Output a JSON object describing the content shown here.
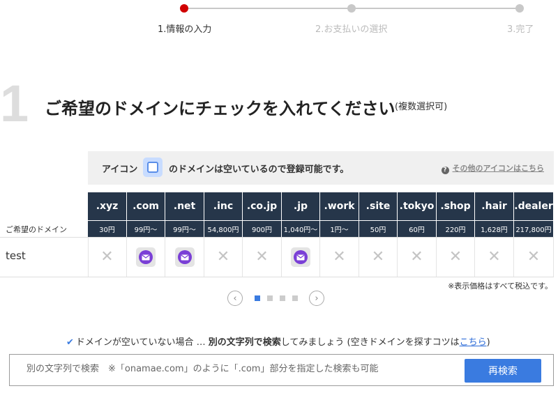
{
  "stepper": {
    "steps": [
      {
        "label": "1.情報の入力"
      },
      {
        "label": "2.お支払いの選択"
      },
      {
        "label": "3.完了"
      }
    ]
  },
  "section": {
    "number": "1",
    "title": "ご希望のドメインにチェックを入れてください",
    "subtitle": "(複数選択可)"
  },
  "legend": {
    "prefix": "アイコン",
    "suffix": "のドメインは空いているので登録可能です。",
    "help_link": "その他のアイコンはこちら"
  },
  "table": {
    "row_label": "ご希望のドメイン",
    "query": "test",
    "tlds": [
      {
        "name": ".xyz",
        "price": "30円",
        "status": "unavailable"
      },
      {
        "name": ".com",
        "price": "99円〜",
        "status": "available"
      },
      {
        "name": ".net",
        "price": "99円〜",
        "status": "available"
      },
      {
        "name": ".inc",
        "price": "54,800円",
        "status": "unavailable"
      },
      {
        "name": ".co.jp",
        "price": "900円",
        "status": "unavailable"
      },
      {
        "name": ".jp",
        "price": "1,040円〜",
        "status": "available"
      },
      {
        "name": ".work",
        "price": "1円〜",
        "status": "unavailable"
      },
      {
        "name": ".site",
        "price": "50円",
        "status": "unavailable"
      },
      {
        "name": ".tokyo",
        "price": "60円",
        "status": "unavailable"
      },
      {
        "name": ".shop",
        "price": "220円",
        "status": "unavailable"
      },
      {
        "name": ".hair",
        "price": "1,628円",
        "status": "unavailable"
      },
      {
        "name": ".dealer",
        "price": "217,800円",
        "status": "unavailable"
      }
    ],
    "tax_note": "※表示価格はすべて税込です。"
  },
  "pagination": {
    "pages": 4,
    "current": 1
  },
  "tip": {
    "pre": "ドメインが空いていない場合 … ",
    "bold": "別の文字列で検索",
    "mid": "してみましょう (空きドメインを探すコツは",
    "link": "こちら",
    "post": ")"
  },
  "search": {
    "value": "",
    "placeholder": "別の文字列で検索　※「onamae.com」のように「.com」部分を指定した検索も可能",
    "button_label": "再検索"
  },
  "colors": {
    "header_bg": "#26364a",
    "accent_blue": "#3a7be0",
    "step_active": "#d00000",
    "available_icon": "#7a3fd6"
  }
}
